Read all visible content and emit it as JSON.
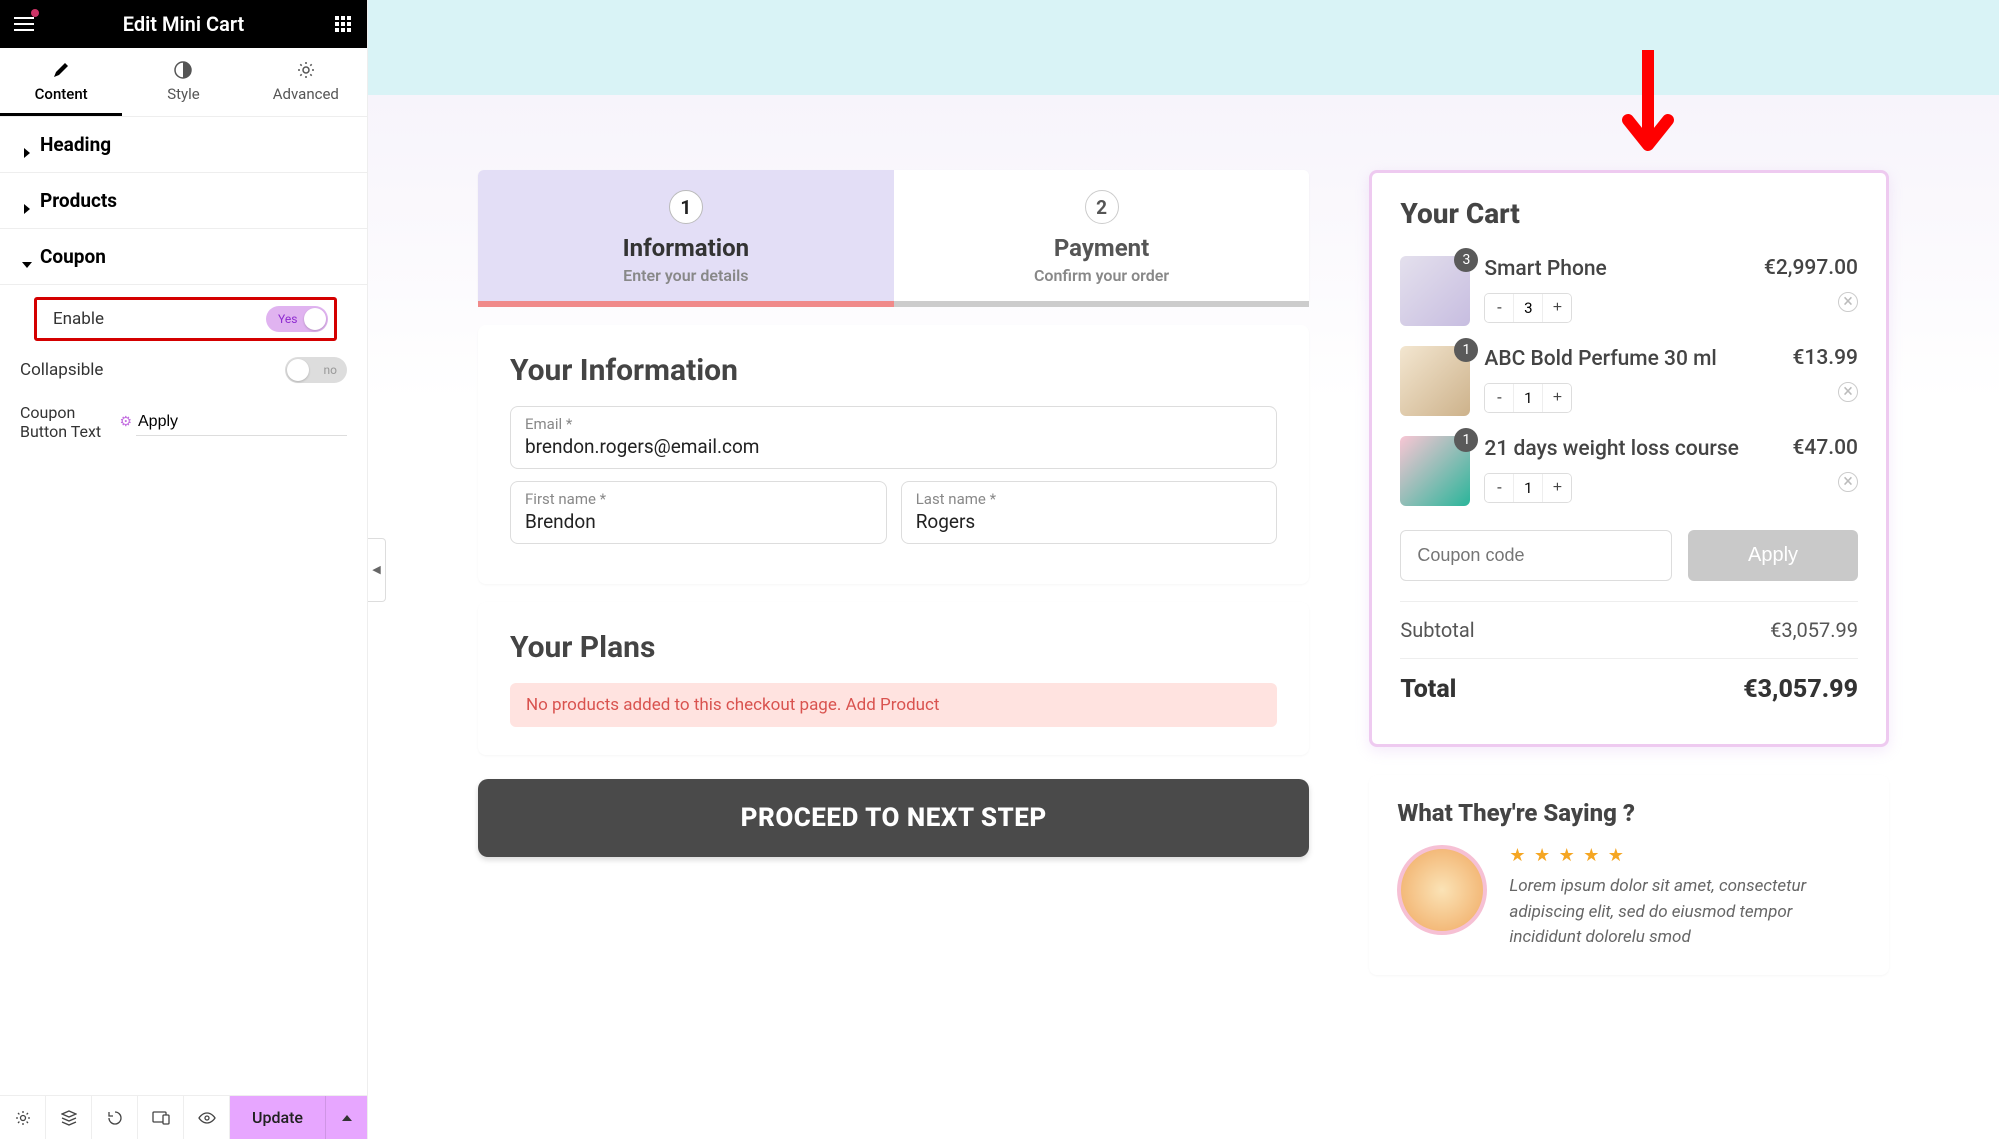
{
  "sidebar": {
    "title": "Edit Mini Cart",
    "tabs": {
      "content": "Content",
      "style": "Style",
      "advanced": "Advanced"
    },
    "sections": {
      "heading": "Heading",
      "products": "Products",
      "coupon": {
        "title": "Coupon",
        "enable_label": "Enable",
        "enable_value": "Yes",
        "collapsible_label": "Collapsible",
        "collapsible_value": "no",
        "coupon_button_text_label": "Coupon Button Text",
        "coupon_button_text_value": "Apply"
      }
    },
    "footer": {
      "update": "Update"
    }
  },
  "steps": {
    "s1": {
      "num": "1",
      "title": "Information",
      "sub": "Enter your details"
    },
    "s2": {
      "num": "2",
      "title": "Payment",
      "sub": "Confirm your order"
    }
  },
  "your_info": {
    "title": "Your Information",
    "email_label": "Email *",
    "email_value": "brendon.rogers@email.com",
    "first_label": "First name *",
    "first_value": "Brendon",
    "last_label": "Last name *",
    "last_value": "Rogers"
  },
  "your_plans": {
    "title": "Your Plans",
    "warning": "No products added to this checkout page. ",
    "warning_link": "Add Product"
  },
  "cta": "PROCEED TO NEXT STEP",
  "cart": {
    "title": "Your Cart",
    "items": [
      {
        "badge": "3",
        "name": "Smart Phone",
        "qty": "3",
        "price": "€2,997.00"
      },
      {
        "badge": "1",
        "name": "ABC Bold Perfume 30 ml",
        "qty": "1",
        "price": "€13.99"
      },
      {
        "badge": "1",
        "name": "21 days weight loss course",
        "qty": "1",
        "price": "€47.00"
      }
    ],
    "coupon_placeholder": "Coupon code",
    "apply": "Apply",
    "subtotal_label": "Subtotal",
    "subtotal_value": "€3,057.99",
    "total_label": "Total",
    "total_value": "€3,057.99"
  },
  "testimonials": {
    "title": "What They're Saying ?",
    "quote": "Lorem ipsum dolor sit amet, consectetur adipiscing elit, sed do eiusmod tempor incididunt dolorelu smod"
  }
}
